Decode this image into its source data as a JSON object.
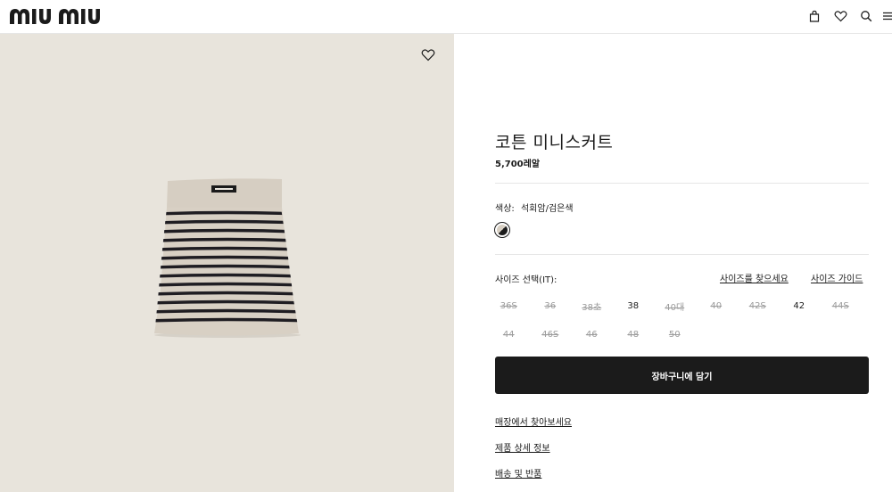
{
  "brand": {
    "logo_text": "MIU MIU"
  },
  "header": {
    "icons": [
      "bag-icon",
      "heart-icon",
      "search-icon",
      "menu-icon"
    ]
  },
  "product": {
    "title": "코튼 미니스커트",
    "price": "5,700레알",
    "color_label": "색상:",
    "color_value": "석회암/검은색",
    "size_label": "사이즈 선택(IT):",
    "find_size_link": "사이즈를 찾으세요",
    "size_guide_link": "사이즈 가이드",
    "sizes": [
      {
        "label": "36S",
        "available": false
      },
      {
        "label": "36",
        "available": false
      },
      {
        "label": "38초",
        "available": false
      },
      {
        "label": "38",
        "available": true
      },
      {
        "label": "40대",
        "available": false
      },
      {
        "label": "40",
        "available": false
      },
      {
        "label": "42S",
        "available": false
      },
      {
        "label": "42",
        "available": true
      },
      {
        "label": "44S",
        "available": false
      },
      {
        "label": "44",
        "available": false
      },
      {
        "label": "46S",
        "available": false
      },
      {
        "label": "46",
        "available": false
      },
      {
        "label": "48",
        "available": false
      },
      {
        "label": "50",
        "available": false
      }
    ],
    "cart_button": "장바구니에 담기",
    "links": [
      "매장에서 찾아보세요",
      "제품 상세 정보",
      "배송 및 반품"
    ]
  },
  "colors": {
    "gallery_bg": "#e8e4dc",
    "primary": "#1b1b1b",
    "unavailable": "#9c9c9c",
    "skirt_base": "#d7cfc3"
  }
}
